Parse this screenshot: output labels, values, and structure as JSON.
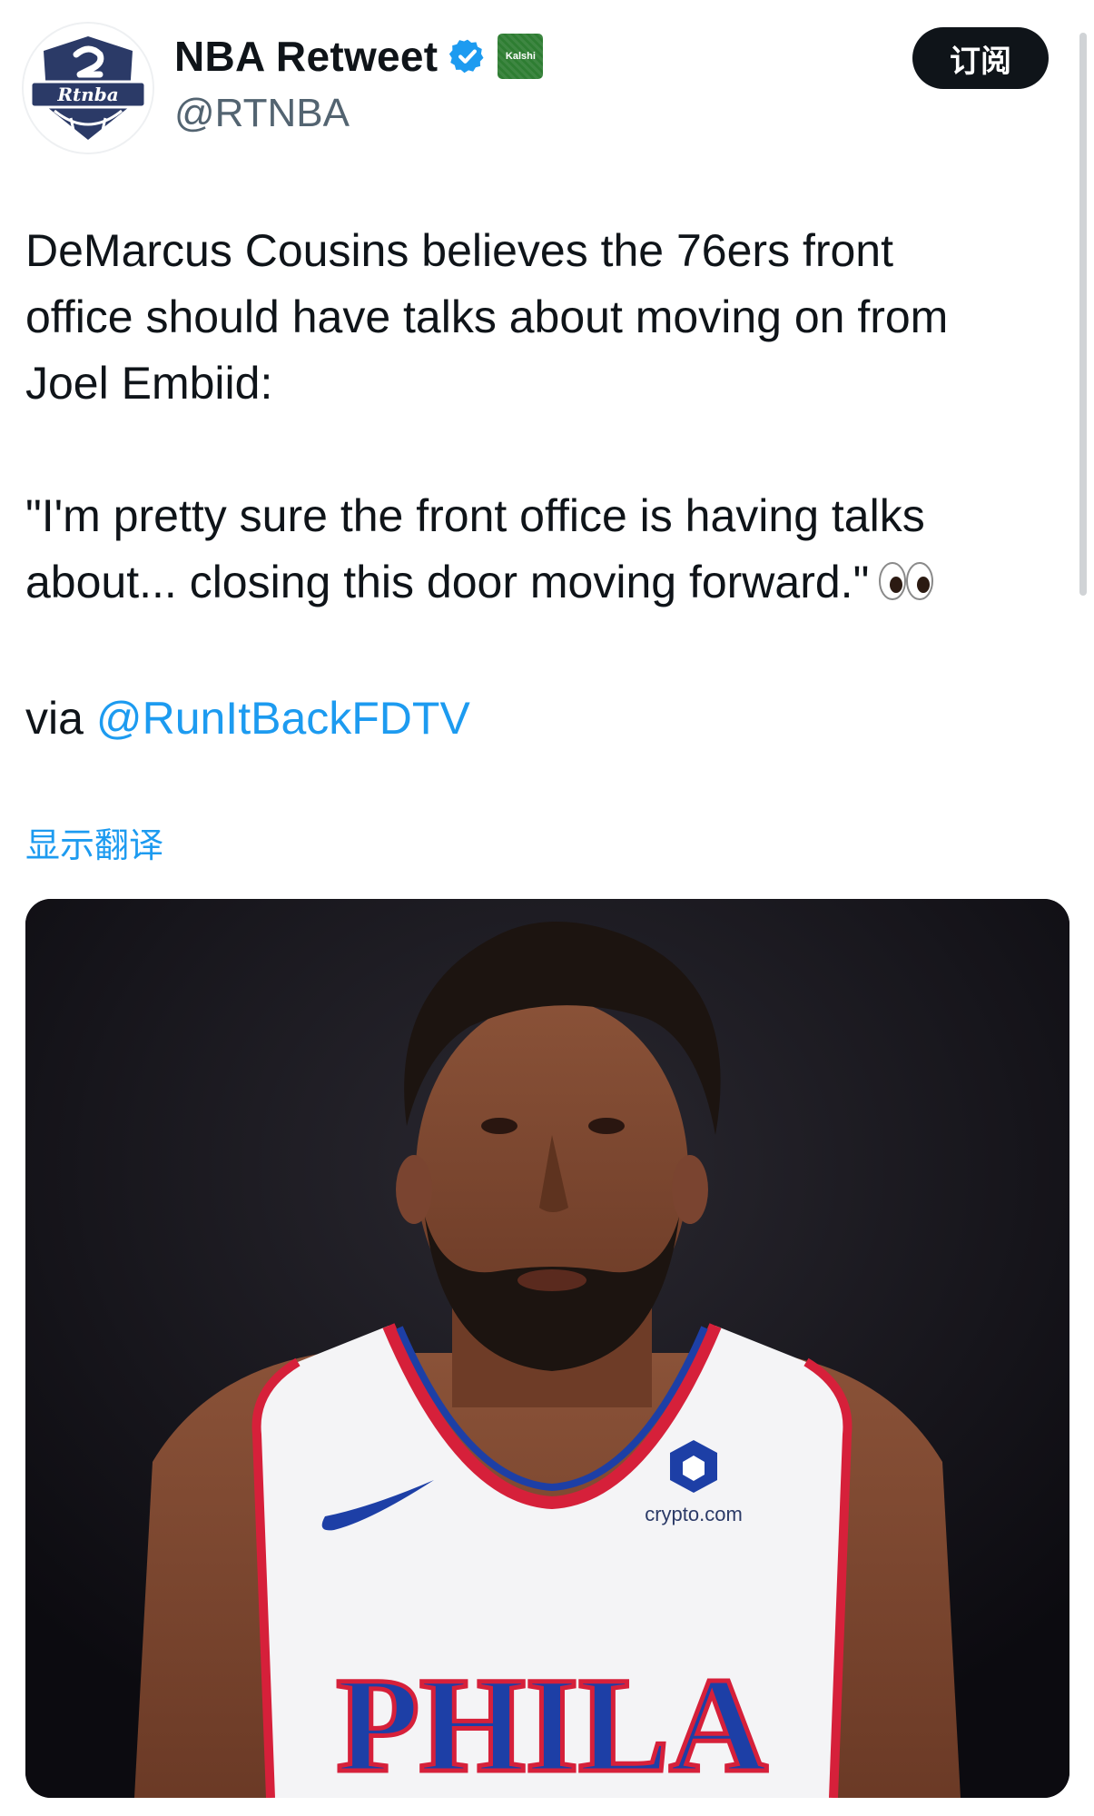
{
  "profile": {
    "name": "NBA Retweet",
    "handle": "@RTNBA",
    "avatar_text": "Rtnba",
    "affiliate_badge": "Kalshi",
    "verified_icon": "verified-badge-icon"
  },
  "actions": {
    "subscribe_label": "订阅"
  },
  "tweet": {
    "line1": "DeMarcus Cousins believes the 76ers front",
    "line2": "office should have talks about moving on from",
    "line3": "Joel Embiid:",
    "quote_line1": "\"I'm pretty sure the front office is having talks",
    "quote_line2": "about... closing this door moving forward.\"",
    "emoji": "eyes-emoji",
    "via": "via",
    "mention": "@RunItBackFDTV"
  },
  "translate_label": "显示翻译",
  "media": {
    "jersey_text": "PHILA",
    "sponsor_text": "crypto.com"
  },
  "colors": {
    "text": "#0f1419",
    "secondary": "#536471",
    "link": "#1d9bf0",
    "verified": "#1d9bf0",
    "kalshi": "#2e7d32",
    "button": "#0f1419",
    "avatar_navy": "#2b3a67",
    "jersey_blue": "#1d3fa6",
    "jersey_red": "#d6203a"
  }
}
